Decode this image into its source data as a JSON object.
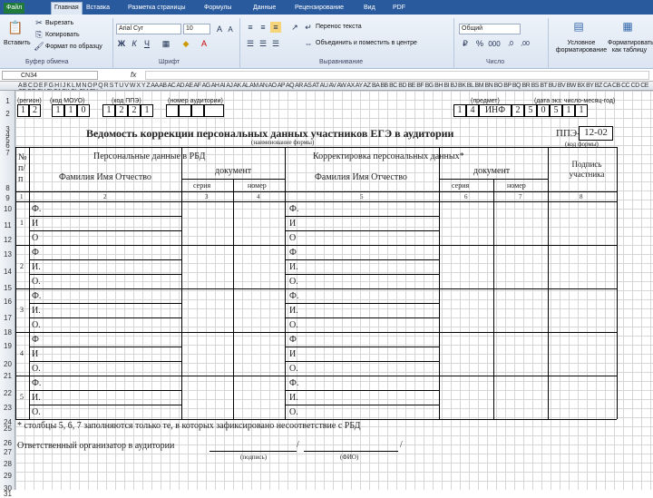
{
  "ribbon": {
    "tabs": [
      "Файл",
      "Главная",
      "Вставка",
      "Разметка страницы",
      "Формулы",
      "Данные",
      "Рецензирование",
      "Вид",
      "PDF"
    ],
    "clipboard": {
      "paste": "Вставить",
      "cut": "Вырезать",
      "copy": "Копировать",
      "format_painter": "Формат по образцу",
      "group": "Буфер обмена"
    },
    "font": {
      "name": "Arial Cyr",
      "size": "10",
      "bold": "Ж",
      "italic": "К",
      "underline": "Ч",
      "group": "Шрифт"
    },
    "alignment": {
      "wrap": "Перенос текста",
      "merge": "Объединить и поместить в центре",
      "group": "Выравнивание"
    },
    "number": {
      "format": "Общий",
      "group": "Число"
    },
    "styles": {
      "conditional": "Условное форматирование",
      "table": "Форматировать как таблицу"
    }
  },
  "formula_bar": {
    "name_box": "CN34",
    "fx": "fx",
    "value": ""
  },
  "col_header": "A B C D E F G H I J K L M N O P Q R S T U V W X Y Z AA AB AC AD AE AF AG AH AI AJ AK AL AM AN AO AP AQ AR AS AT AU AV AW AX AY AZ BA BB BC BD BE BF BG BH BI BJ BK BL BM BN BO BP BQ BR BS BT BU BV BW BX BY BZ CA CB CC CD CE CF CG CH CI CJ CK CL CM CN",
  "row_numbers": [
    "1",
    "2",
    "3",
    "4",
    "5",
    "6",
    "7",
    "8",
    "9",
    "10",
    "11",
    "12",
    "13",
    "14",
    "15",
    "16",
    "17",
    "18",
    "19",
    "20",
    "21",
    "22",
    "23",
    "24",
    "25",
    "26",
    "27",
    "28",
    "29",
    "30",
    "31"
  ],
  "sheet": {
    "labels": {
      "region": "(регион)",
      "mouo": "(код МОУО)",
      "ppe": "(код ППЭ)",
      "auditorium": "(номер аудитории)",
      "subject": "(предмет)",
      "date": "(дата экз: число-месяц-год)"
    },
    "codes": {
      "region": [
        "1",
        "2"
      ],
      "mouo": [
        "1",
        "1",
        "0"
      ],
      "ppe": [
        "1",
        "2",
        "2",
        "1"
      ],
      "right": [
        "1",
        "4",
        "ИНФ",
        "2",
        "5",
        "0",
        "5",
        "1",
        "1"
      ]
    },
    "title": "Ведомость коррекции персональных данных участников ЕГЭ в аудитории",
    "form_name_note": "(наименование формы)",
    "form_code_prefix": "ППЭ-",
    "form_code": "12-02",
    "form_code_note": "(код формы)",
    "headers": {
      "num": "№ п/п",
      "rbd": "Персональные данные в РБД",
      "fio": "Фамилия Имя Отчество",
      "doc": "документ",
      "series": "серия",
      "number": "номер",
      "correction": "Корректировка персональных данных*",
      "fio2": "Фамилия Имя Отчество",
      "doc2": "документ",
      "series2": "серия",
      "number2": "номер",
      "sign": "Подпись участника"
    },
    "col_nums": [
      "1",
      "2",
      "3",
      "4",
      "5",
      "6",
      "7",
      "8"
    ],
    "rows": [
      {
        "n": "1",
        "left": [
          "Ф.",
          "И",
          "О"
        ],
        "right": [
          "Ф.",
          "И",
          "О"
        ]
      },
      {
        "n": "2",
        "left": [
          "Ф",
          "И.",
          "О."
        ],
        "right": [
          "Ф",
          "И.",
          "О."
        ]
      },
      {
        "n": "3",
        "left": [
          "Ф.",
          "И.",
          "О."
        ],
        "right": [
          "Ф.",
          "И.",
          "О."
        ]
      },
      {
        "n": "4",
        "left": [
          "Ф",
          "И",
          "О."
        ],
        "right": [
          "Ф",
          "И",
          "О."
        ]
      },
      {
        "n": "5",
        "left": [
          "Ф.",
          "И.",
          "О."
        ],
        "right": [
          "Ф.",
          "И.",
          "О."
        ]
      }
    ],
    "footnote": "* столбцы 5, 6, 7 заполняются только те, в которых зафиксировано несоответствие с РБД",
    "organizer": "Ответственный организатор в аудитории",
    "slash1": "/",
    "slash2": "/",
    "sign_note": "(подпись)",
    "fio_note": "(ФИО)"
  }
}
